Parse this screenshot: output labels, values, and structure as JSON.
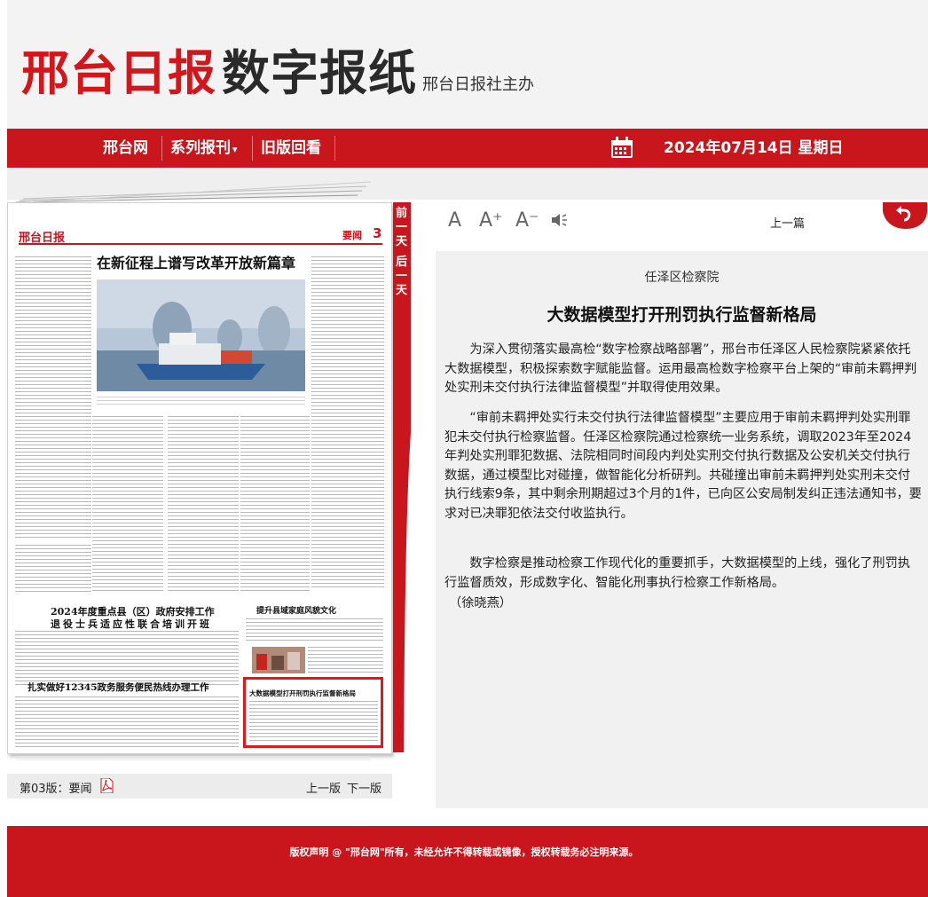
{
  "header": {
    "logo_red": "邢台日报",
    "logo_dark": "数字报纸",
    "logo_sub": "邢台日报社主办"
  },
  "nav": {
    "items": [
      "邢台网",
      "系列报刊",
      "旧版回看"
    ],
    "dropdown_caret": "▾",
    "date": "2024年07月14日 星期日"
  },
  "paper": {
    "masthead": "邢台日报",
    "edition_tag": "要闻",
    "page_num": "3",
    "headline": "在新征程上谱写改革开放新篇章",
    "sections": [
      "2024年度重点县（区）政府安排工作",
      "退役士兵适应性联合培训开班",
      "扎实做好12345政务服务便民热线办理工作",
      "提升县域家庭风貌文化",
      "大数据模型打开刑罚执行监督新格局"
    ]
  },
  "side_tabs": {
    "prev_day": "前一天",
    "next_day": "后一天"
  },
  "page_bar": {
    "label": "第03版：要闻",
    "prev": "上一版",
    "next": "下一版"
  },
  "toolbar": {
    "font_normal": "A",
    "font_up": "A⁺",
    "font_down": "A⁻",
    "prev_article": "上一篇"
  },
  "article": {
    "source": "任泽区检察院",
    "title": "大数据模型打开刑罚执行监督新格局",
    "paragraphs": [
      "为深入贯彻落实最高检“数字检察战略部署”，邢台市任泽区人民检察院紧紧依托大数据模型，积极探索数字赋能监督。运用最高检数字检察平台上架的“审前未羁押判处实刑未交付执行法律监督模型”并取得使用效果。",
      "“审前未羁押处实行未交付执行法律监督模型”主要应用于审前未羁押判处实刑罪犯未交付执行检察监督。任泽区检察院通过检察统一业务系统，调取2023年至2024年判处实刑罪犯数据、法院相同时间段内判处实刑交付执行数据及公安机关交付执行数据，通过模型比对碰撞，做智能化分析研判。共碰撞出审前未羁押判处实刑未交付执行线索9条，其中剩余刑期超过3个月的1件，已向区公安局制发纠正违法通知书，要求对已决罪犯依法交付收监执行。",
      "数字检察是推动检察工作现代化的重要抓手，大数据模型的上线，强化了刑罚执行监督质效，形成数字化、智能化刑事执行检察工作新格局。"
    ],
    "signature": "（徐晓燕）"
  },
  "footer": {
    "copyright": "版权声明 @ \"邢台网\"所有，未经允许不得转载或镜像，授权转载务必注明来源。"
  },
  "colors": {
    "brand_red": "#c9151c",
    "highlight_red": "#e3161b"
  }
}
